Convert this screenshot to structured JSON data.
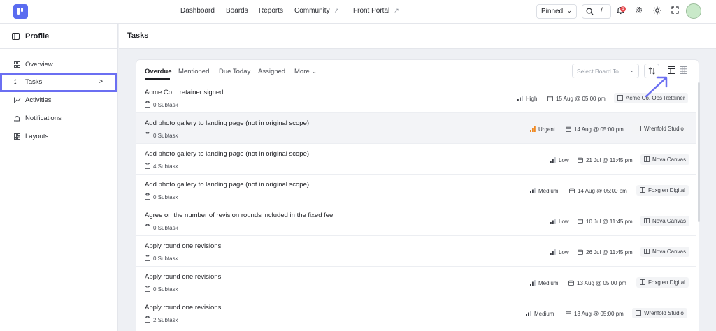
{
  "topbar": {
    "nav": [
      "Dashboard",
      "Boards",
      "Reports",
      "Community",
      "Front Portal"
    ],
    "nav_external": [
      "↗",
      "↗"
    ],
    "pinned_label": "Pinned",
    "search_shortcut": "/",
    "notification_count": "1"
  },
  "sidebar": {
    "title": "Profile",
    "items": [
      {
        "label": "Overview"
      },
      {
        "label": "Tasks"
      },
      {
        "label": "Activities"
      },
      {
        "label": "Notifications"
      },
      {
        "label": "Layouts"
      }
    ],
    "active_arrow": ">"
  },
  "main": {
    "title": "Tasks",
    "tabs": [
      "Overdue",
      "Mentioned",
      "Due Today",
      "Assigned",
      "More"
    ],
    "more_chevron": "⌄",
    "select_board_placeholder": "Select Board To ...",
    "rows": [
      {
        "title": "Acme Co. : retainer signed",
        "subtask": "0 Subtask",
        "priority": "High",
        "due": "15 Aug @ 05:00 pm",
        "board": "Acme Co. Ops Retainer"
      },
      {
        "title": "Add photo gallery to landing page (not in original scope)",
        "subtask": "0 Subtask",
        "priority": "Urgent",
        "due": "14 Aug @ 05:00 pm",
        "board": "Wrenfold Studio"
      },
      {
        "title": "Add photo gallery to landing page (not in original scope)",
        "subtask": "4 Subtask",
        "priority": "Low",
        "due": "21 Jul @ 11:45 pm",
        "board": "Nova Canvas"
      },
      {
        "title": "Add photo gallery to landing page (not in original scope)",
        "subtask": "0 Subtask",
        "priority": "Medium",
        "due": "14 Aug @ 05:00 pm",
        "board": "Foxglen Digital"
      },
      {
        "title": "Agree on the number of revision rounds included in the fixed fee",
        "subtask": "0 Subtask",
        "priority": "Low",
        "due": "10 Jul @ 11:45 pm",
        "board": "Nova Canvas"
      },
      {
        "title": "Apply round one revisions",
        "subtask": "0 Subtask",
        "priority": "Low",
        "due": "26 Jul @ 11:45 pm",
        "board": "Nova Canvas"
      },
      {
        "title": "Apply round one revisions",
        "subtask": "0 Subtask",
        "priority": "Medium",
        "due": "13 Aug @ 05:00 pm",
        "board": "Foxglen Digital"
      },
      {
        "title": "Apply round one revisions",
        "subtask": "2 Subtask",
        "priority": "Medium",
        "due": "13 Aug @ 05:00 pm",
        "board": "Wrenfold Studio"
      }
    ]
  },
  "colors": {
    "accent": "#5a6cf0",
    "urgent": "#f08a24",
    "annotation": "#6b6ff2"
  }
}
